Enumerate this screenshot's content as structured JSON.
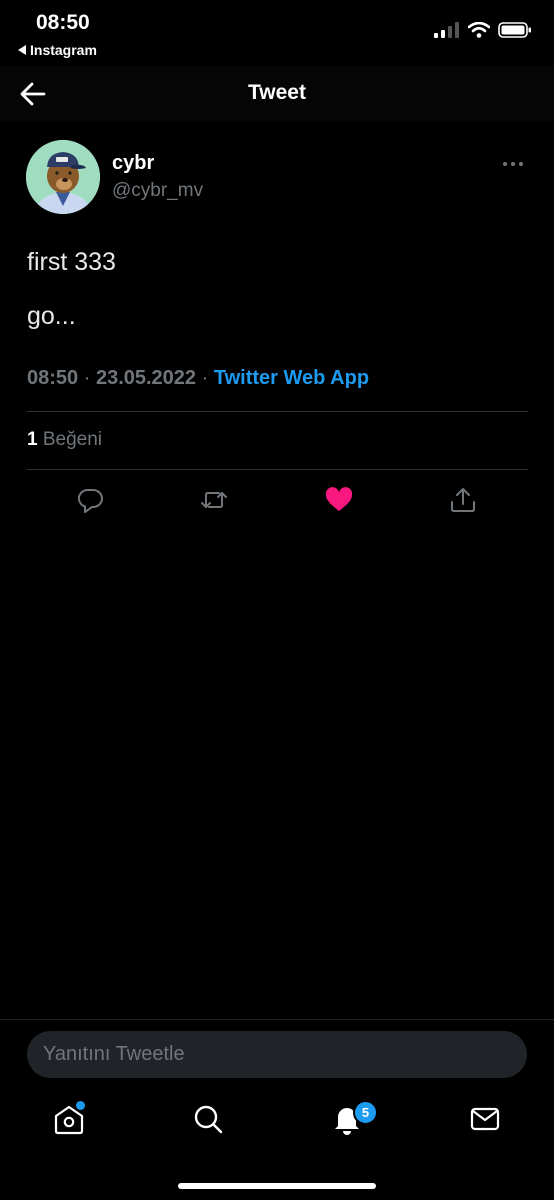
{
  "status_bar": {
    "time": "08:50",
    "back_app": "Instagram"
  },
  "header": {
    "title": "Tweet"
  },
  "tweet": {
    "display_name": "cybr",
    "handle": "@cybr_mv",
    "lines": [
      "first 333",
      "go..."
    ],
    "time": "08:50",
    "date": "23.05.2022",
    "separator": "·",
    "source": "Twitter Web App",
    "likes_count": "1",
    "likes_label": "Beğeni"
  },
  "colors": {
    "background": "#000000",
    "accent": "#1d9bf0",
    "like": "#f91880",
    "muted": "#71767b"
  },
  "reply": {
    "placeholder": "Yanıtını Tweetle"
  },
  "tabbar": {
    "notifications_badge": "5",
    "icons": [
      "home-icon",
      "search-icon",
      "bell-icon",
      "mail-icon"
    ]
  }
}
